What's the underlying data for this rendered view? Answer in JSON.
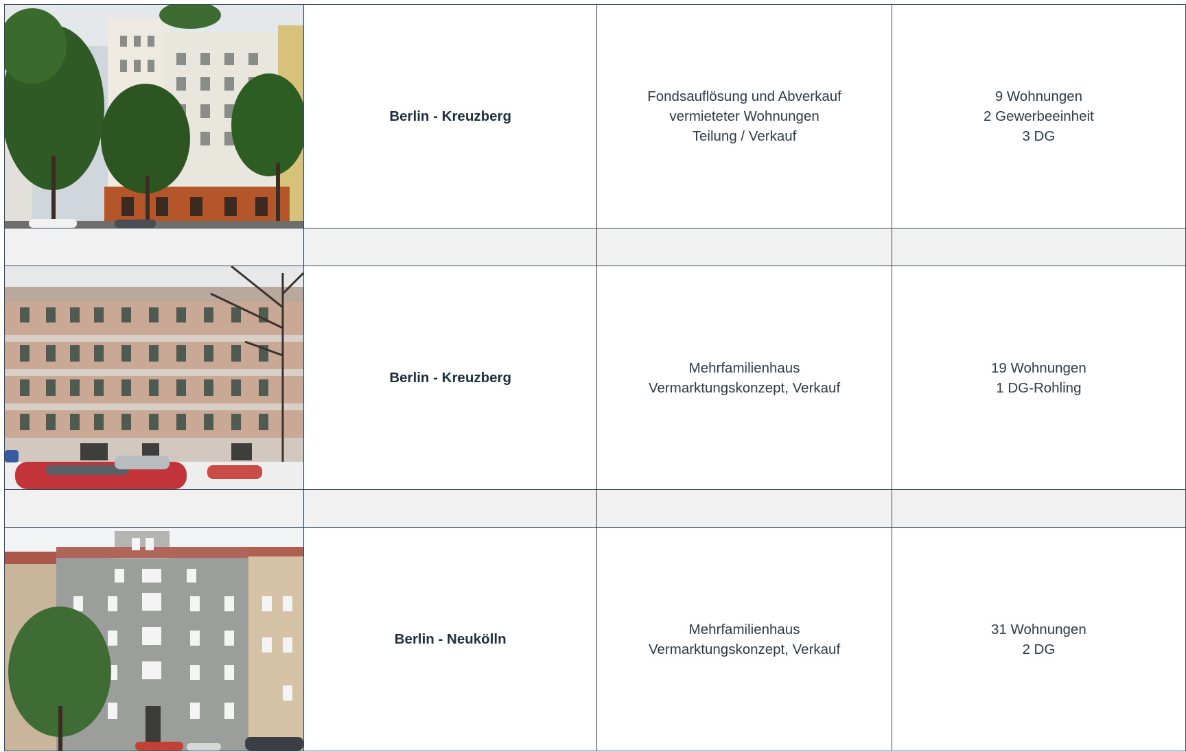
{
  "colors": {
    "border": "#36475a",
    "spacer_fill": "#f1f1f1",
    "text": "#2e3a48",
    "location_text": "#1f2f40"
  },
  "rows": [
    {
      "photo": "building-photo",
      "location": "Berlin - Kreuzberg",
      "description": [
        "Fondsauflösung und Abverkauf",
        "vermieteter Wohnungen",
        "Teilung / Verkauf"
      ],
      "units": [
        "9 Wohnungen",
        "2 Gewerbeeinheit",
        "3 DG"
      ]
    },
    {
      "photo": "building-photo",
      "location": "Berlin - Kreuzberg",
      "description": [
        "Mehrfamilienhaus",
        "Vermarktungskonzept, Verkauf"
      ],
      "units": [
        "19 Wohnungen",
        "1 DG-Rohling"
      ]
    },
    {
      "photo": "building-photo",
      "location": "Berlin - Neukölln",
      "description": [
        "Mehrfamilienhaus",
        "Vermarktungskonzept, Verkauf"
      ],
      "units": [
        "31 Wohnungen",
        "2 DG"
      ]
    }
  ]
}
